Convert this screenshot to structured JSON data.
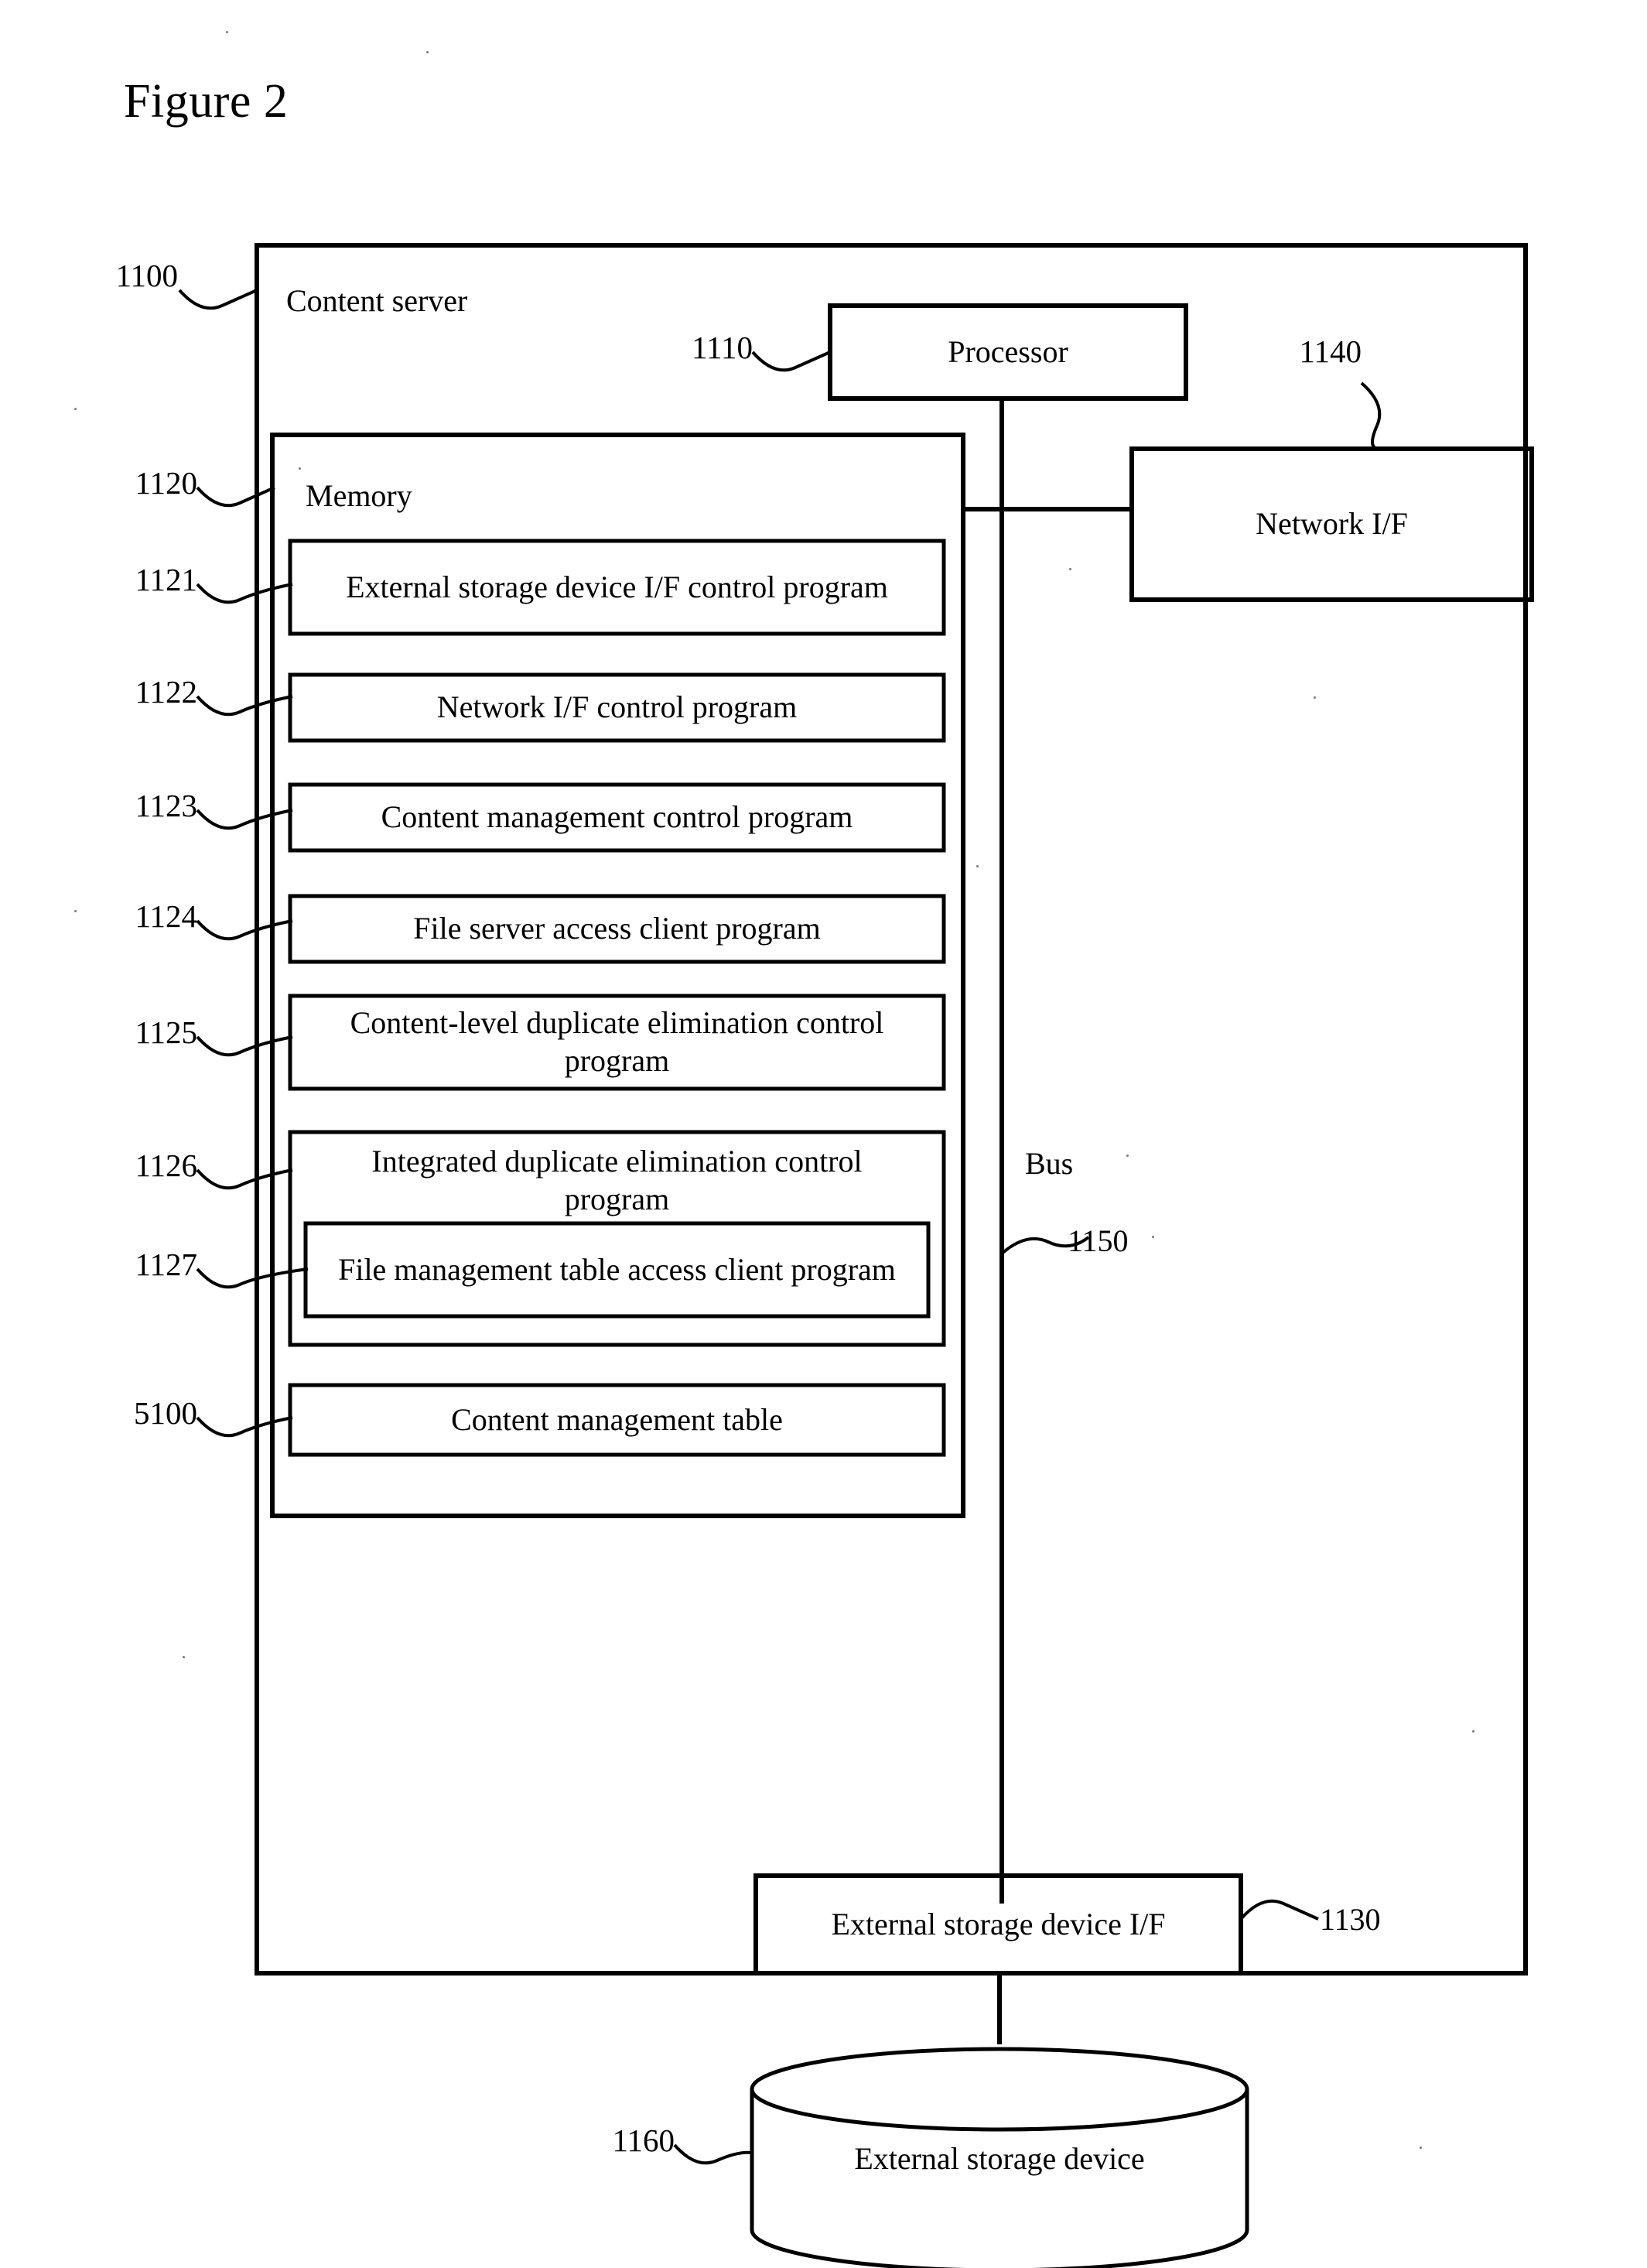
{
  "figure": {
    "title": "Figure 2"
  },
  "server": {
    "ref": "1100",
    "label": "Content server"
  },
  "processor": {
    "ref": "1110",
    "label": "Processor"
  },
  "network_if": {
    "ref": "1140",
    "label": "Network I/F"
  },
  "memory": {
    "ref": "1120",
    "label": "Memory",
    "items": [
      {
        "ref": "1121",
        "label": "External storage device I/F control program"
      },
      {
        "ref": "1122",
        "label": "Network I/F control program"
      },
      {
        "ref": "1123",
        "label": "Content management control program"
      },
      {
        "ref": "1124",
        "label": "File server access client program"
      },
      {
        "ref": "1125",
        "label": "Content-level duplicate elimination control program"
      },
      {
        "ref": "1126",
        "label": "Integrated duplicate elimination control program"
      },
      {
        "ref": "1127",
        "label": "File management table access client program"
      },
      {
        "ref": "5100",
        "label": "Content management table"
      }
    ]
  },
  "bus": {
    "ref": "1150",
    "label": "Bus"
  },
  "external_storage_if": {
    "ref": "1130",
    "label": "External storage device I/F"
  },
  "external_storage_device": {
    "ref": "1160",
    "label": "External storage device"
  }
}
